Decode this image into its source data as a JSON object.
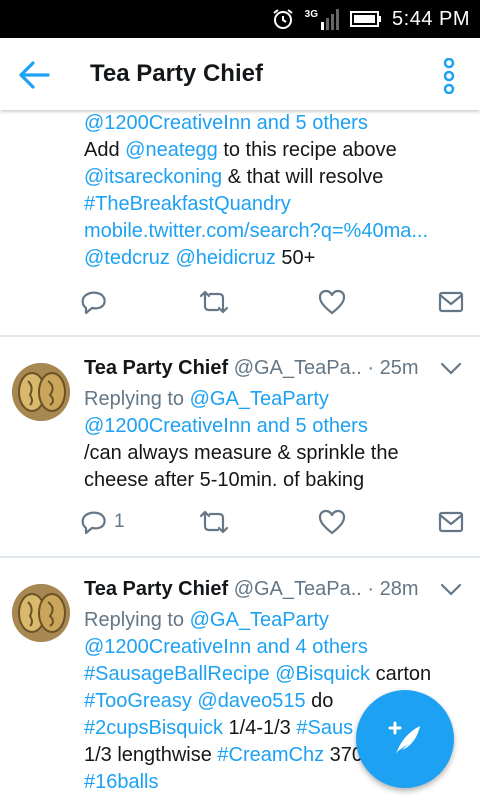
{
  "status": {
    "network": "3G",
    "time": "5:44 PM"
  },
  "header": {
    "title": "Tea Party Chief"
  },
  "tweets": [
    {
      "lines": [
        [
          {
            "t": "@1200CreativeInn and 5 others",
            "c": "blue"
          }
        ],
        [
          {
            "t": "Add ",
            "c": ""
          },
          {
            "t": "@neategg",
            "c": "blue"
          },
          {
            "t": " to this recipe above",
            "c": ""
          }
        ],
        [
          {
            "t": "@itsareckoning",
            "c": "blue"
          },
          {
            "t": " & that will resolve",
            "c": ""
          }
        ],
        [
          {
            "t": "#TheBreakfastQuandry",
            "c": "blue"
          }
        ],
        [
          {
            "t": "mobile.twitter.com/search?q=%40ma...",
            "c": "blue"
          }
        ],
        [
          {
            "t": "@tedcruz",
            "c": "blue"
          },
          {
            "t": " ",
            "c": ""
          },
          {
            "t": "@heidicruz",
            "c": "blue"
          },
          {
            "t": " 50+",
            "c": ""
          }
        ]
      ],
      "reply_count": ""
    },
    {
      "author": "Tea Party Chief",
      "handle": "@GA_TeaPa..",
      "time": "· 25m",
      "lines": [
        [
          {
            "t": "Replying to ",
            "c": "gray"
          },
          {
            "t": "@GA_TeaParty",
            "c": "blue"
          }
        ],
        [
          {
            "t": "@1200CreativeInn and 5 others",
            "c": "blue"
          }
        ],
        [
          {
            "t": "/can always measure & sprinkle the",
            "c": ""
          }
        ],
        [
          {
            "t": "cheese after 5-10min. of baking",
            "c": ""
          }
        ]
      ],
      "reply_count": "1"
    },
    {
      "author": "Tea Party Chief",
      "handle": "@GA_TeaPa..",
      "time": "· 28m",
      "lines": [
        [
          {
            "t": "Replying to ",
            "c": "gray"
          },
          {
            "t": "@GA_TeaParty",
            "c": "blue"
          }
        ],
        [
          {
            "t": "@1200CreativeInn and 4 others",
            "c": "blue"
          }
        ],
        [
          {
            "t": "#SausageBallRecipe",
            "c": "blue"
          },
          {
            "t": " ",
            "c": ""
          },
          {
            "t": "@Bisquick",
            "c": "blue"
          },
          {
            "t": " carton",
            "c": ""
          }
        ],
        [
          {
            "t": "#TooGreasy",
            "c": "blue"
          },
          {
            "t": " ",
            "c": ""
          },
          {
            "t": "@daveo515",
            "c": "blue"
          },
          {
            "t": " do",
            "c": ""
          }
        ],
        [
          {
            "t": "#2cupsBisquick",
            "c": "blue"
          },
          {
            "t": " 1/4-1/3 ",
            "c": ""
          },
          {
            "t": "#Saus",
            "c": "blue"
          }
        ],
        [
          {
            "t": "1/3 lengthwise ",
            "c": ""
          },
          {
            "t": "#CreamChz",
            "c": "blue"
          },
          {
            "t": " 370",
            "c": ""
          }
        ],
        [
          {
            "t": "#16balls",
            "c": "blue"
          }
        ]
      ],
      "reply_count": ""
    }
  ],
  "icons": {
    "back": "arrow-left-icon",
    "more": "more-vertical-icon",
    "reply": "reply-icon",
    "retweet": "retweet-icon",
    "like": "heart-icon",
    "dm": "envelope-icon",
    "caret": "chevron-down-icon",
    "compose": "compose-feather-icon"
  },
  "colors": {
    "accent": "#1da1f2",
    "muted": "#657786",
    "text": "#14171a",
    "divider": "#e1e8ed"
  }
}
